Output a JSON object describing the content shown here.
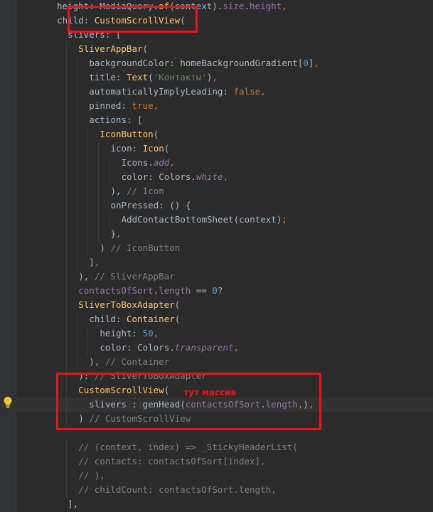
{
  "editor": {
    "lines": [
      [
        [
          "t-d",
          "height: MediaQuery."
        ],
        [
          "t-c",
          "of"
        ],
        [
          "t-d",
          "(context)."
        ],
        [
          "t-p",
          "size"
        ],
        [
          "t-d",
          "."
        ],
        [
          "t-p",
          "height"
        ],
        [
          "t-k",
          ","
        ]
      ],
      [
        [
          "t-d",
          "child: "
        ],
        [
          "t-c",
          "CustomScrollView"
        ],
        [
          "t-d",
          "("
        ]
      ],
      [
        [
          "t-d",
          "slivers: ["
        ]
      ],
      [
        [
          "t-c",
          "SliverAppBar"
        ],
        [
          "t-d",
          "("
        ]
      ],
      [
        [
          "t-d",
          "backgroundColor: homeBackgroundGradient["
        ],
        [
          "t-n",
          "0"
        ],
        [
          "t-d",
          "]"
        ],
        [
          "t-k",
          ","
        ]
      ],
      [
        [
          "t-d",
          "title: "
        ],
        [
          "t-c",
          "Text"
        ],
        [
          "t-d",
          "("
        ],
        [
          "t-s",
          "'Контакты'"
        ],
        [
          "t-d",
          ")"
        ],
        [
          "t-k",
          ","
        ]
      ],
      [
        [
          "t-d",
          "automaticallyImplyLeading: "
        ],
        [
          "t-k",
          "false,"
        ]
      ],
      [
        [
          "t-d",
          "pinned: "
        ],
        [
          "t-k",
          "true,"
        ]
      ],
      [
        [
          "t-d",
          "actions: ["
        ]
      ],
      [
        [
          "t-c",
          "IconButton"
        ],
        [
          "t-d",
          "("
        ]
      ],
      [
        [
          "t-d",
          "icon: "
        ],
        [
          "t-c",
          "Icon"
        ],
        [
          "t-d",
          "("
        ]
      ],
      [
        [
          "t-d",
          "Icons."
        ],
        [
          "t-pi",
          "add"
        ],
        [
          "t-k",
          ","
        ]
      ],
      [
        [
          "t-d",
          "color: Colors."
        ],
        [
          "t-pi",
          "white"
        ],
        [
          "t-k",
          ","
        ]
      ],
      [
        [
          "t-d",
          "), "
        ],
        [
          "t-m",
          "// Icon"
        ]
      ],
      [
        [
          "t-d",
          "onPressed: () {"
        ]
      ],
      [
        [
          "t-d",
          "AddContactBottomSheet(context)"
        ],
        [
          "t-k",
          ";"
        ]
      ],
      [
        [
          "t-d",
          "}"
        ],
        [
          "t-k",
          ","
        ]
      ],
      [
        [
          "t-d",
          ") "
        ],
        [
          "t-m",
          "// IconButton"
        ]
      ],
      [
        [
          "t-d",
          "]"
        ],
        [
          "t-k",
          ","
        ]
      ],
      [
        [
          "t-d",
          "), "
        ],
        [
          "t-m",
          "// SliverAppBar"
        ]
      ],
      [
        [
          "t-p",
          "contactsOfSort"
        ],
        [
          "t-d",
          "."
        ],
        [
          "t-p",
          "length"
        ],
        [
          "t-d",
          " == "
        ],
        [
          "t-n",
          "0"
        ],
        [
          "t-d",
          "?"
        ]
      ],
      [
        [
          "t-c",
          "SliverToBoxAdapter"
        ],
        [
          "t-d",
          "("
        ]
      ],
      [
        [
          "t-d",
          "child: "
        ],
        [
          "t-c",
          "Container"
        ],
        [
          "t-d",
          "("
        ]
      ],
      [
        [
          "t-d",
          "height: "
        ],
        [
          "t-n",
          "50"
        ],
        [
          "t-k",
          ","
        ]
      ],
      [
        [
          "t-d",
          "color: Colors."
        ],
        [
          "t-pi",
          "transparent"
        ],
        [
          "t-k",
          ","
        ]
      ],
      [
        [
          "t-d",
          "), "
        ],
        [
          "t-m",
          "// Container"
        ]
      ],
      [
        [
          "t-d",
          "): "
        ],
        [
          "t-m",
          "// SliverToBoxAdapter"
        ]
      ],
      [
        [
          "t-c",
          "CustomScrollView"
        ],
        [
          "t-d",
          "("
        ]
      ],
      [
        [
          "t-d",
          "slivers : genHead("
        ],
        [
          "t-p",
          "contactsOfSort"
        ],
        [
          "t-d",
          "."
        ],
        [
          "t-p",
          "length"
        ],
        [
          "t-k",
          ","
        ],
        [
          "t-d",
          ")"
        ],
        [
          "t-k",
          ","
        ]
      ],
      [
        [
          "t-d",
          ") "
        ],
        [
          "t-m",
          "// CustomScrollView"
        ]
      ],
      [],
      [
        [
          "t-m",
          "// (context, index) => _StickyHeaderList("
        ]
      ],
      [
        [
          "t-m",
          "// contacts: contactsOfSort[index],"
        ]
      ],
      [
        [
          "t-m",
          "// ),"
        ]
      ],
      [
        [
          "t-m",
          "// childCount: contactsOfSort.length,"
        ]
      ],
      [
        [
          "t-d",
          "],"
        ]
      ]
    ]
  },
  "annotation": {
    "text": "тут массив"
  },
  "colors": {
    "highlight": "#e8141b",
    "background": "#2b2b2b"
  },
  "icons": {
    "gutter": "lightbulb-icon"
  }
}
